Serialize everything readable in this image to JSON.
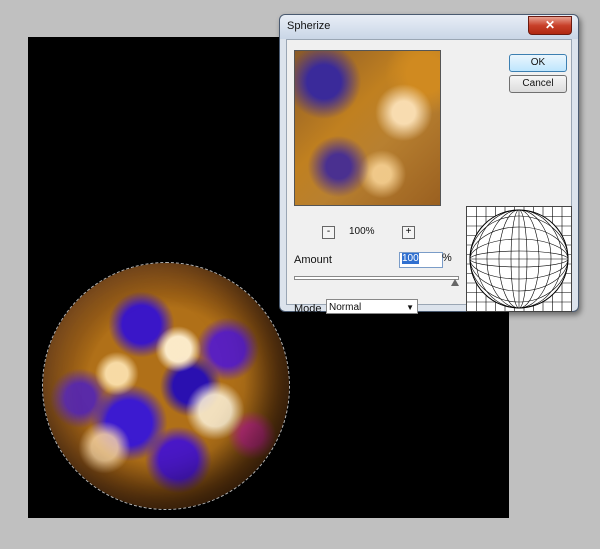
{
  "dialog": {
    "title": "Spherize",
    "close_label": "✕",
    "ok_label": "OK",
    "cancel_label": "Cancel",
    "zoom": {
      "minus": "-",
      "plus": "+",
      "level": "100%"
    },
    "amount": {
      "label": "Amount",
      "value": "100",
      "unit": "%"
    },
    "mode": {
      "label": "Mode",
      "selected": "Normal"
    }
  }
}
